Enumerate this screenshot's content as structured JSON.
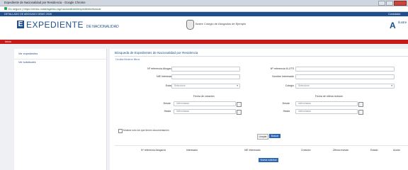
{
  "window": {
    "title": "Expediente de Nacionalidad por Residencia - Google Chrome"
  },
  "address_bar": {
    "url": "Es seguro | https://demo.notariagenia.org/nacionalidad/expediente/buscar"
  },
  "bookmark_bar": {
    "label": "DETALLADO DE ABOGADO DEMO 2026",
    "right_label": "Conectado"
  },
  "header": {
    "logo_letter": "E",
    "logo_text": "EXPEDIENTE",
    "logo_suffix": "DE NACIONALIDAD",
    "org_name": "Ilustre Colegio de Abogados de Ejemplo",
    "right_logo_letter": "A",
    "right_logo_text": "Ilustre"
  },
  "nav": {
    "item": "Inicio"
  },
  "sidebar": {
    "items": [
      {
        "label": "Ver expedientes"
      },
      {
        "label": "Ver solicitudes"
      }
    ]
  },
  "main": {
    "title": "Búsqueda de Expedientes de Nacionalidad por Residencia",
    "subtitle": "Ocultar/Mostrar filtros",
    "form": {
      "left": {
        "ref_label": "Nº referencia Abogacía",
        "nie_label": "NIE Interesado",
        "estado_label": "Estado",
        "estado_value": "Seleccione"
      },
      "right": {
        "ref_label": "Nº referencia M.J/TS",
        "name_label": "Nombre Interesado",
        "colegio_label": "Colegio",
        "colegio_value": "Seleccione"
      },
      "date_group_left": {
        "title": "Fecha de creación",
        "from_label": "Desde",
        "to_label": "Hasta",
        "placeholder": "dd/mm/aaaa"
      },
      "date_group_right": {
        "title": "Fecha de última revisión",
        "from_label": "Desde",
        "to_label": "Hasta",
        "placeholder": "dd/mm/aaaa"
      },
      "checkbox_label": "Mostrar sólo los que tienen documentación"
    },
    "buttons": {
      "clear": "Limpiar",
      "search": "Buscar"
    },
    "table": {
      "headers": [
        "Nº referencia Abogacía",
        "Interesado",
        "NIE Interesado",
        "Creación",
        "Última revisión",
        "Estado",
        "Acción"
      ]
    },
    "new_button": "Nueva solicitud"
  }
}
